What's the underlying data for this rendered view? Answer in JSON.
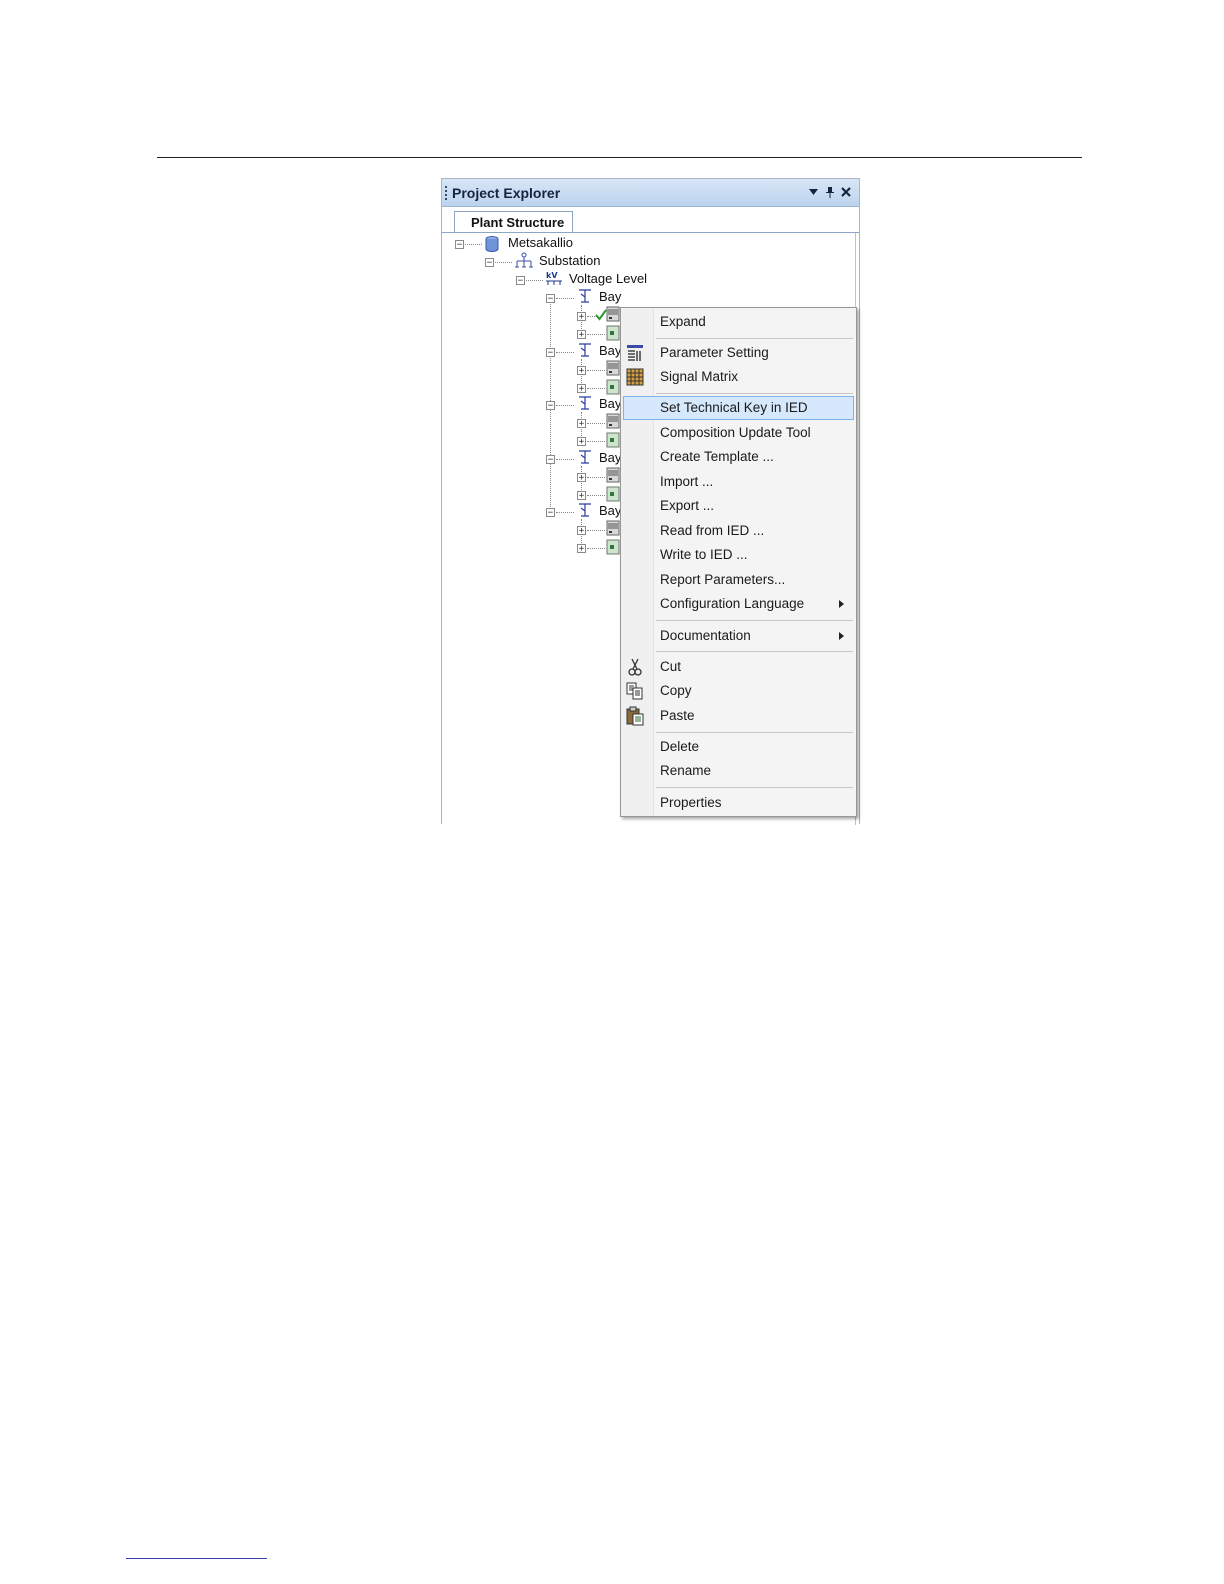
{
  "panel": {
    "title": "Project Explorer",
    "tab": "Plant Structure",
    "controls": [
      "dropdown-icon",
      "pin-icon",
      "close-icon"
    ]
  },
  "tree": {
    "root": "Metsakallio",
    "substation": "Substation",
    "voltage_level": "Voltage Level",
    "bays": [
      "Bay",
      "Bay",
      "Bay",
      "Bay",
      "Bay"
    ]
  },
  "context_menu": {
    "items": [
      {
        "label": "Expand"
      },
      {
        "label": "Parameter Setting",
        "icon": "parameter-setting-icon"
      },
      {
        "label": "Signal Matrix",
        "icon": "signal-matrix-icon"
      },
      {
        "label": "Set Technical Key in IED",
        "highlighted": true
      },
      {
        "label": "Composition Update Tool"
      },
      {
        "label": "Create Template ..."
      },
      {
        "label": "Import ..."
      },
      {
        "label": "Export ..."
      },
      {
        "label": "Read from IED ..."
      },
      {
        "label": "Write to IED ..."
      },
      {
        "label": "Report Parameters..."
      },
      {
        "label": "Configuration Language",
        "submenu": true
      },
      {
        "label": "Documentation",
        "submenu": true
      },
      {
        "label": "Cut",
        "icon": "scissors-icon"
      },
      {
        "label": "Copy",
        "icon": "copy-icon"
      },
      {
        "label": "Paste",
        "icon": "paste-icon"
      },
      {
        "label": "Delete"
      },
      {
        "label": "Rename"
      },
      {
        "label": "Properties"
      }
    ]
  },
  "colors": {
    "titlebar": "#bcd3ee",
    "highlight": "#d6e8fb",
    "highlight_border": "#7eb4ea"
  }
}
